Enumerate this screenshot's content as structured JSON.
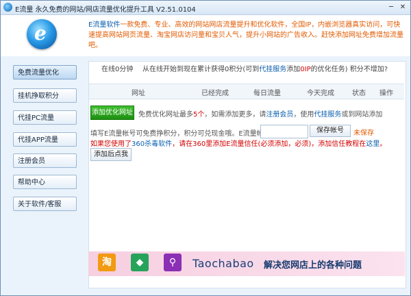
{
  "window": {
    "title": "E流量 永久免费的网站/网店流量优化提升工具 V2.51.0104",
    "minimize": "─",
    "close": "✕"
  },
  "header": {
    "logo_letter": "e",
    "intro_brand": "E流量软件",
    "intro_text": "一款免费、专业、高效的网站网店流量提升和优化软件，全国IP，内嵌浏览器真实访问，可快速提高网站网页流量、淘宝网店访问量和宝贝人气，提升小网站的广告收入。赶快添加网址免费增加流量吧。"
  },
  "sidebar": {
    "items": [
      {
        "label": "免费流量优化",
        "active": true
      },
      {
        "label": "挂机挣取积分",
        "active": false
      },
      {
        "label": "代挂PC流量",
        "active": false
      },
      {
        "label": "代挂APP流量",
        "active": false
      },
      {
        "label": "注册会员",
        "active": false
      },
      {
        "label": "帮助中心",
        "active": false
      },
      {
        "label": "关于软件/客服",
        "active": false
      }
    ]
  },
  "status": {
    "online": "在线0分钟",
    "desc_a": "从在线开始到现在累计获得0积分(可到",
    "desc_link": "代挂服务",
    "desc_b": "添加",
    "desc_red": "0IP",
    "desc_c": "的优化任务)",
    "question": "积分不增加?"
  },
  "table": {
    "columns": [
      "网址",
      "已经完成",
      "每日流量",
      "今天完成",
      "状态",
      "操作"
    ]
  },
  "add": {
    "button": "添加优化网址",
    "note_a": "免费优化网址最多",
    "note_count": "5个",
    "note_b": "，如需添加更多，请",
    "note_link1": "注册会员",
    "note_c": "，使用",
    "note_link2": "代挂服务",
    "note_d": "或到网站添加"
  },
  "account": {
    "label": "填写E流量帐号可免费挣积分，积分可兑现金哦。E流量帐号:",
    "input_value": "",
    "save_button": "保存帐号",
    "unsaved": "未保存"
  },
  "warning": {
    "text_a": "如果您使用了",
    "soft": "360杀毒软件",
    "text_b": "，请在360里添加E流量信任(必须添加，必须)，添加信任教程在",
    "link": "这里",
    "text_c": "。"
  },
  "add_later_button": "添加后点我",
  "banner": {
    "icon1": "淘",
    "icon2": "◆",
    "icon3": "⚲",
    "brand": "Taochabao",
    "slogan": "解决您网店上的各种问题"
  }
}
